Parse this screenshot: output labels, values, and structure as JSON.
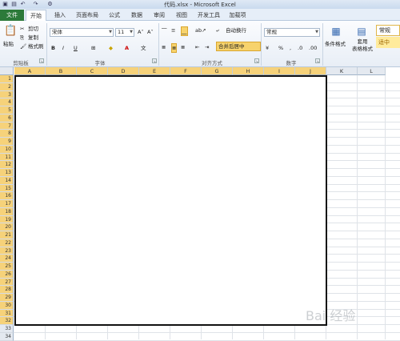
{
  "title": "代码.xlsx - Microsoft Excel",
  "tabs": [
    "文件",
    "开始",
    "插入",
    "页面布局",
    "公式",
    "数据",
    "审阅",
    "视图",
    "开发工具",
    "加载项"
  ],
  "clipboard": {
    "paste": "粘贴",
    "cut": "剪切",
    "copy": "复制",
    "format_painter": "格式刷",
    "label": "剪贴板"
  },
  "font": {
    "name": "宋体",
    "size": "11",
    "bold": "B",
    "italic": "I",
    "underline": "U",
    "label": "字体"
  },
  "alignment": {
    "wrap_text": "自动换行",
    "merge_center": "合并后居中",
    "label": "对齐方式"
  },
  "number": {
    "format": "常规",
    "label": "数字"
  },
  "styles": {
    "conditional_format": "条件格式",
    "format_as_table": "套用\n表格格式",
    "normal": "常规",
    "good": "适中"
  },
  "columns": [
    "A",
    "B",
    "C",
    "D",
    "E",
    "F",
    "G",
    "H",
    "I",
    "J",
    "K",
    "L"
  ],
  "rows": [
    "1",
    "2",
    "3",
    "4",
    "5",
    "6",
    "7",
    "8",
    "9",
    "10",
    "11",
    "12",
    "13",
    "14",
    "15",
    "16",
    "17",
    "18",
    "19",
    "20",
    "21",
    "22",
    "23",
    "24",
    "25",
    "26",
    "27",
    "28",
    "29",
    "30",
    "31",
    "32",
    "33",
    "34"
  ],
  "watermark": "Bai 经验"
}
